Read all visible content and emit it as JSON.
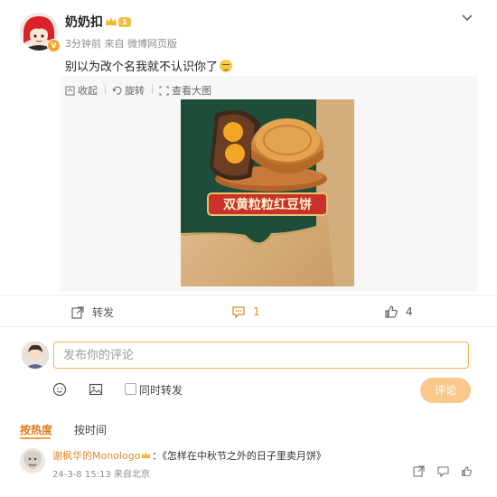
{
  "post": {
    "username": "奶奶扣",
    "level": "1",
    "meta": "3分钟前 来自 微博网页版",
    "text": "别以为改个名我就不认识你了",
    "verified_badge": "V"
  },
  "media_tools": {
    "collect": "收起",
    "rotate": "旋转",
    "view_large": "查看大图"
  },
  "image": {
    "banner_text": "双黄粒粒红豆饼"
  },
  "actions": {
    "repost": "转发",
    "comment_count": "1",
    "like_count": "4"
  },
  "composer": {
    "placeholder": "发布你的评论",
    "also_repost": "同时转发",
    "submit": "评论"
  },
  "sort_tabs": {
    "hot": "按热度",
    "time": "按时间"
  },
  "comment": {
    "author": "谢枫华的Monologo",
    "colon": "：",
    "text": "《怎样在中秋节之外的日子里卖月饼》",
    "meta": "24-3-8 15:13 来自北京"
  },
  "colors": {
    "accent": "#f1a03a",
    "send_button": "#f9c98c",
    "input_border": "#f0b34a",
    "banner_red": "#c8322a",
    "image_green": "#1e4d3a"
  }
}
